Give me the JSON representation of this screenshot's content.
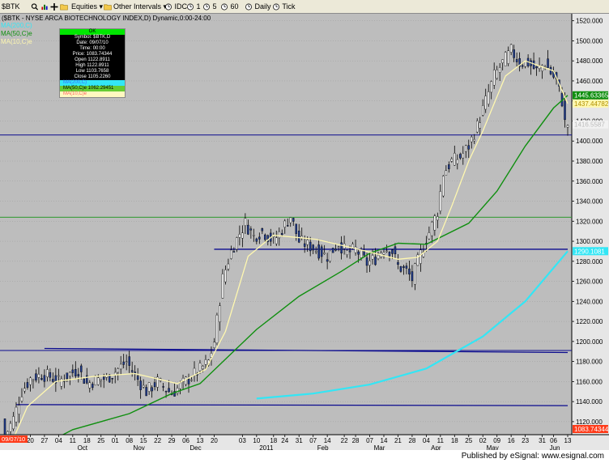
{
  "toolbar": {
    "symbol_field": "$BTK",
    "equities_menu": "Equities",
    "other_intervals_menu": "Other Intervals",
    "intervals": [
      "IDC",
      "1",
      "5",
      "60",
      "Daily",
      "Tick"
    ]
  },
  "chart_title": "($BTK - NYSE ARCA BIOTECHNOLOGY INDEX,D) Dynamic,0:00-24:00",
  "legend": {
    "ma200_label": "MA(200,C)",
    "ma50_label": "MA(50,C)e",
    "ma10_label": "MA(10,C)e"
  },
  "infobox": {
    "ok": "OK",
    "symbol": "Symbol: $BTK,D",
    "date": "Date: 09/07/10",
    "time": "Time: 00:00",
    "price": "Price: 1083.74344",
    "open": "Open 1122.8911",
    "high": "High 1122.8911",
    "low": "Low 1103.7658",
    "close": "Close 1105.2260",
    "ma200": "MA(200,C)",
    "ma50": "MA(50,C)e 1062.29451",
    "ma10": "MA(10,C)e"
  },
  "cursor_date": "09/07/10",
  "cursor_price": "1083.74344",
  "footer_text": "Published by eSignal: www.esignal.com",
  "colors": {
    "background": "#bdbdbd",
    "up_candle": "#ffffff",
    "down_candle": "#1f3a8a",
    "ma10": "#fff8b0",
    "ma50": "#0f8f0f",
    "ma200": "#33e6f5",
    "blue_lines": "#0b0b8f",
    "green_line": "#2e9a2e",
    "price_tag_bg": "#ff3b1a"
  },
  "chart_data": {
    "type": "candlestick",
    "y_ticks": [
      1120,
      1140,
      1160,
      1180,
      1200,
      1220,
      1240,
      1260,
      1280,
      1300,
      1320,
      1340,
      1360,
      1380,
      1400,
      1420,
      1440,
      1460,
      1480,
      1500,
      1520
    ],
    "ylim": [
      1107,
      1527
    ],
    "x_tick_labels": [
      "20",
      "27",
      "04",
      "11",
      "18",
      "25",
      "01",
      "08",
      "15",
      "22",
      "29",
      "06",
      "13",
      "20",
      "03",
      "10",
      "18",
      "24",
      "31",
      "07",
      "14",
      "22",
      "28",
      "07",
      "14",
      "21",
      "28",
      "04",
      "11",
      "18",
      "25",
      "02",
      "09",
      "16",
      "23",
      "31",
      "06",
      "13"
    ],
    "month_labels": [
      "Oct",
      "Nov",
      "Dec",
      "2011",
      "Feb",
      "Mar",
      "Apr",
      "May",
      "Jun"
    ],
    "price_labels": [
      {
        "value": 1445.63365,
        "text": "1445.63365",
        "series": "ma50"
      },
      {
        "value": 1437.44782,
        "text": "1437.44782",
        "series": "ma10"
      },
      {
        "value": 1416.5587,
        "text": "1416.5587",
        "series": "close"
      },
      {
        "value": 1290.1081,
        "text": "1290.1081",
        "series": "ma200"
      }
    ],
    "hlines": [
      {
        "value": 1406,
        "color": "blue"
      },
      {
        "value": 1324,
        "color": "green"
      },
      {
        "value": 1191,
        "color": "blue"
      }
    ],
    "trendlines": [
      {
        "from": [
          "2010-09-27",
          1193
        ],
        "to": [
          "2011-06-13",
          1189
        ],
        "color": "blue"
      },
      {
        "from": [
          "2010-09-13",
          1137
        ],
        "to": [
          "2011-06-13",
          1136
        ],
        "color": "blue"
      },
      {
        "from": [
          "2010-12-20",
          1292
        ],
        "to": [
          "2011-06-13",
          1292
        ],
        "color": "blue"
      }
    ],
    "ohlc_keypoints": [
      [
        "2010-09-07",
        1105
      ],
      [
        "2010-09-10",
        1123
      ],
      [
        "2010-09-15",
        1150
      ],
      [
        "2010-09-20",
        1163
      ],
      [
        "2010-09-24",
        1167
      ],
      [
        "2010-09-29",
        1165
      ],
      [
        "2010-10-04",
        1160
      ],
      [
        "2010-10-08",
        1168
      ],
      [
        "2010-10-13",
        1172
      ],
      [
        "2010-10-18",
        1158
      ],
      [
        "2010-10-22",
        1162
      ],
      [
        "2010-10-27",
        1163
      ],
      [
        "2010-11-01",
        1170
      ],
      [
        "2010-11-05",
        1180
      ],
      [
        "2010-11-10",
        1166
      ],
      [
        "2010-11-16",
        1150
      ],
      [
        "2010-11-22",
        1160
      ],
      [
        "2010-11-29",
        1148
      ],
      [
        "2010-12-03",
        1158
      ],
      [
        "2010-12-08",
        1165
      ],
      [
        "2010-12-13",
        1172
      ],
      [
        "2010-12-16",
        1180
      ],
      [
        "2010-12-20",
        1200
      ],
      [
        "2010-12-23",
        1263
      ],
      [
        "2010-12-28",
        1290
      ],
      [
        "2010-12-31",
        1308
      ],
      [
        "2011-01-04",
        1318
      ],
      [
        "2011-01-07",
        1305
      ],
      [
        "2011-01-12",
        1310
      ],
      [
        "2011-01-18",
        1300
      ],
      [
        "2011-01-21",
        1312
      ],
      [
        "2011-01-26",
        1325
      ],
      [
        "2011-01-31",
        1300
      ],
      [
        "2011-02-04",
        1295
      ],
      [
        "2011-02-09",
        1290
      ],
      [
        "2011-02-14",
        1285
      ],
      [
        "2011-02-18",
        1298
      ],
      [
        "2011-02-23",
        1288
      ],
      [
        "2011-02-28",
        1292
      ],
      [
        "2011-03-04",
        1278
      ],
      [
        "2011-03-09",
        1283
      ],
      [
        "2011-03-14",
        1294
      ],
      [
        "2011-03-17",
        1290
      ],
      [
        "2011-03-21",
        1275
      ],
      [
        "2011-03-24",
        1270
      ],
      [
        "2011-03-28",
        1262
      ],
      [
        "2011-03-30",
        1280
      ],
      [
        "2011-04-04",
        1302
      ],
      [
        "2011-04-08",
        1330
      ],
      [
        "2011-04-12",
        1368
      ],
      [
        "2011-04-15",
        1380
      ],
      [
        "2011-04-20",
        1384
      ],
      [
        "2011-04-25",
        1395
      ],
      [
        "2011-04-28",
        1415
      ],
      [
        "2011-05-03",
        1440
      ],
      [
        "2011-05-06",
        1465
      ],
      [
        "2011-05-11",
        1478
      ],
      [
        "2011-05-16",
        1490
      ],
      [
        "2011-05-19",
        1478
      ],
      [
        "2011-05-24",
        1478
      ],
      [
        "2011-05-27",
        1470
      ],
      [
        "2011-06-01",
        1478
      ],
      [
        "2011-06-03",
        1468
      ],
      [
        "2011-06-07",
        1460
      ],
      [
        "2011-06-09",
        1440
      ],
      [
        "2011-06-10",
        1418
      ],
      [
        "2011-06-13",
        1416.56
      ]
    ],
    "ma200": [
      [
        "2011-01-10",
        1143
      ],
      [
        "2011-02-07",
        1148
      ],
      [
        "2011-03-07",
        1157
      ],
      [
        "2011-04-04",
        1173
      ],
      [
        "2011-05-02",
        1205
      ],
      [
        "2011-05-23",
        1240
      ],
      [
        "2011-06-13",
        1290.1
      ]
    ],
    "ma50": [
      [
        "2010-09-07",
        1062.3
      ],
      [
        "2010-09-20",
        1090
      ],
      [
        "2010-10-11",
        1112
      ],
      [
        "2010-11-08",
        1128
      ],
      [
        "2010-11-29",
        1148
      ],
      [
        "2010-12-13",
        1158
      ],
      [
        "2010-12-27",
        1185
      ],
      [
        "2011-01-10",
        1212
      ],
      [
        "2011-01-31",
        1245
      ],
      [
        "2011-02-21",
        1270
      ],
      [
        "2011-03-07",
        1288
      ],
      [
        "2011-03-21",
        1298
      ],
      [
        "2011-04-04",
        1297
      ],
      [
        "2011-04-25",
        1318
      ],
      [
        "2011-05-09",
        1350
      ],
      [
        "2011-05-23",
        1395
      ],
      [
        "2011-06-06",
        1433
      ],
      [
        "2011-06-13",
        1445.6
      ]
    ],
    "ma10": [
      [
        "2010-09-07",
        1083.7
      ],
      [
        "2010-09-17",
        1135
      ],
      [
        "2010-10-01",
        1160
      ],
      [
        "2010-10-20",
        1165
      ],
      [
        "2010-11-10",
        1168
      ],
      [
        "2010-12-01",
        1158
      ],
      [
        "2010-12-15",
        1172
      ],
      [
        "2010-12-24",
        1210
      ],
      [
        "2011-01-05",
        1285
      ],
      [
        "2011-01-18",
        1306
      ],
      [
        "2011-02-08",
        1302
      ],
      [
        "2011-03-01",
        1292
      ],
      [
        "2011-03-21",
        1282
      ],
      [
        "2011-03-30",
        1284
      ],
      [
        "2011-04-08",
        1300
      ],
      [
        "2011-04-15",
        1335
      ],
      [
        "2011-04-25",
        1380
      ],
      [
        "2011-05-02",
        1410
      ],
      [
        "2011-05-12",
        1465
      ],
      [
        "2011-05-23",
        1480
      ],
      [
        "2011-06-06",
        1470
      ],
      [
        "2011-06-13",
        1437.4
      ]
    ]
  }
}
